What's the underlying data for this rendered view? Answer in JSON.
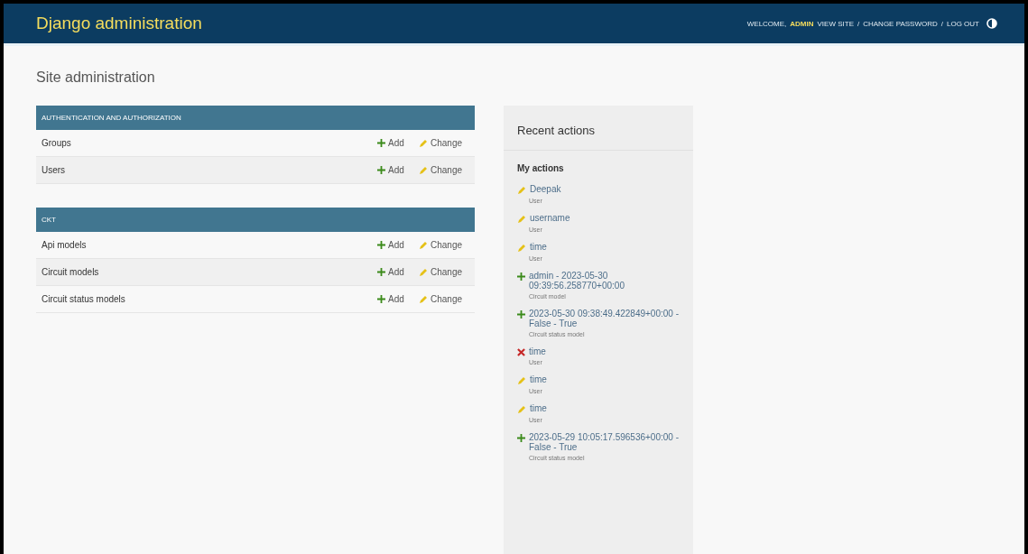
{
  "header": {
    "title": "Django administration",
    "welcome": "WELCOME,",
    "user": "ADMIN",
    "links": [
      "VIEW SITE",
      "CHANGE PASSWORD",
      "LOG OUT"
    ],
    "separator": "/"
  },
  "page_title": "Site administration",
  "modules": [
    {
      "caption": "AUTHENTICATION AND AUTHORIZATION",
      "rows": [
        {
          "name": "Groups",
          "add": "Add",
          "change": "Change"
        },
        {
          "name": "Users",
          "add": "Add",
          "change": "Change"
        }
      ]
    },
    {
      "caption": "CKT",
      "rows": [
        {
          "name": "Api models",
          "add": "Add",
          "change": "Change"
        },
        {
          "name": "Circuit models",
          "add": "Add",
          "change": "Change"
        },
        {
          "name": "Circuit status models",
          "add": "Add",
          "change": "Change"
        }
      ]
    }
  ],
  "recent": {
    "title": "Recent actions",
    "subtitle": "My actions",
    "items": [
      {
        "kind": "change",
        "label": "Deepak",
        "type": "User"
      },
      {
        "kind": "change",
        "label": "username",
        "type": "User"
      },
      {
        "kind": "change",
        "label": "time",
        "type": "User"
      },
      {
        "kind": "add",
        "label": "admin - 2023-05-30 09:39:56.258770+00:00",
        "type": "Circuit model"
      },
      {
        "kind": "add",
        "label": "2023-05-30 09:38:49.422849+00:00 - False - True",
        "type": "Circuit status model"
      },
      {
        "kind": "delete",
        "label": "time",
        "type": "User"
      },
      {
        "kind": "change",
        "label": "time",
        "type": "User"
      },
      {
        "kind": "change",
        "label": "time",
        "type": "User"
      },
      {
        "kind": "add",
        "label": "2023-05-29 10:05:17.596536+00:00 - False - True",
        "type": "Circuit status model"
      }
    ]
  }
}
